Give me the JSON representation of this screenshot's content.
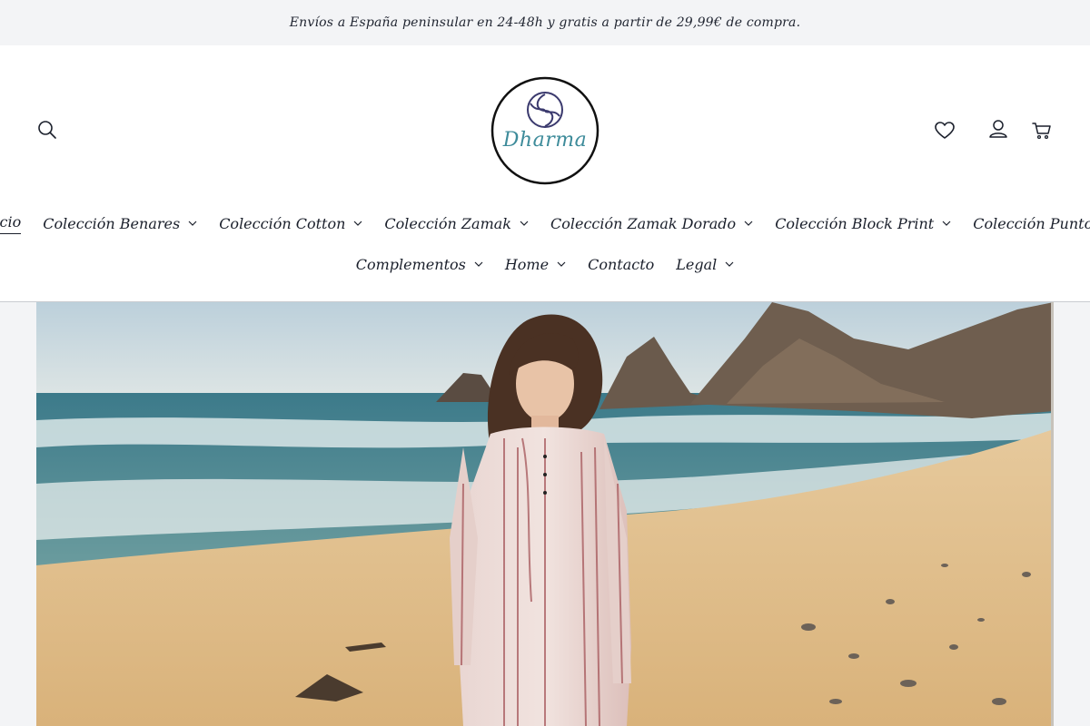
{
  "announcement": {
    "text": "Envíos a España peninsular en 24-48h y gratis a partir de 29,99€ de compra."
  },
  "header": {
    "logo_text": "Dharma",
    "icons": {
      "search": "search-icon",
      "wishlist": "heart-icon",
      "account": "user-icon",
      "cart": "cart-icon"
    }
  },
  "nav": {
    "row1": [
      {
        "label": "Inicio",
        "dropdown": false,
        "active": true
      },
      {
        "label": "Colección Benares",
        "dropdown": true
      },
      {
        "label": "Colección Cotton",
        "dropdown": true
      },
      {
        "label": "Colección Zamak",
        "dropdown": true
      },
      {
        "label": "Colección Zamak Dorado",
        "dropdown": true
      },
      {
        "label": "Colección Block Print",
        "dropdown": true
      },
      {
        "label": "Colección Punto",
        "dropdown": true
      }
    ],
    "row2": [
      {
        "label": "Complementos",
        "dropdown": true
      },
      {
        "label": "Home",
        "dropdown": true
      },
      {
        "label": "Contacto",
        "dropdown": false
      },
      {
        "label": "Legal",
        "dropdown": true
      }
    ]
  },
  "colors": {
    "announcement_bg": "#f3f4f6",
    "header_bg": "#ffffff",
    "text": "#1a1f2b",
    "logo_accent": "#3d8b9a",
    "logo_swirl": "#3b3a6e"
  }
}
